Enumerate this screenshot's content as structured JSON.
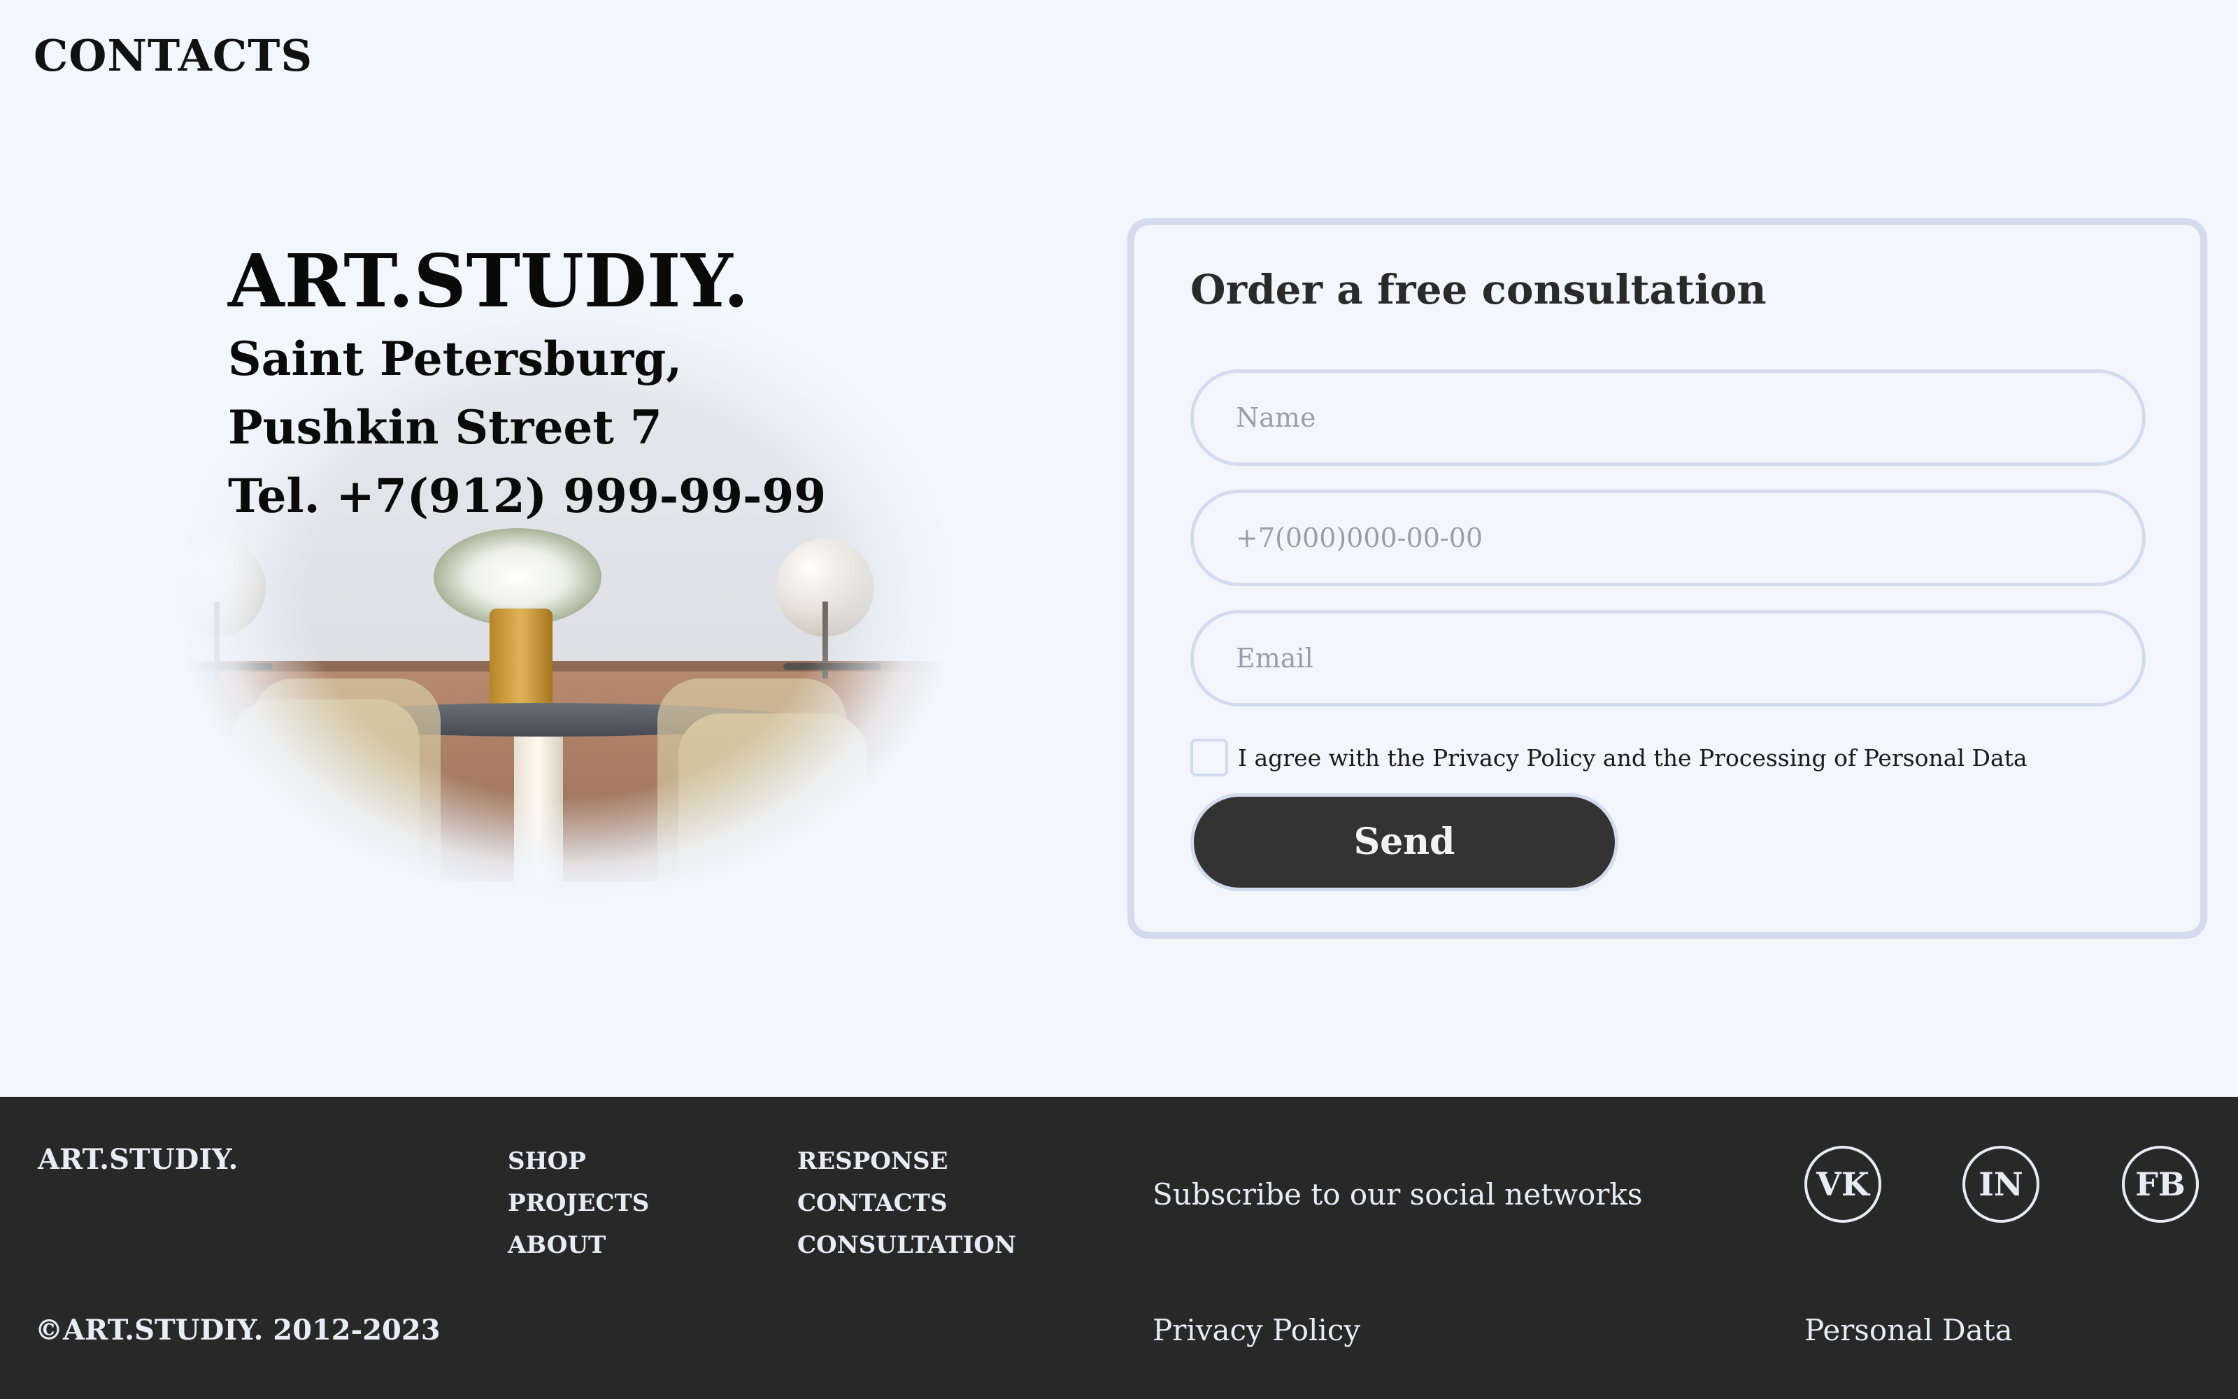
{
  "section": {
    "title": "CONTACTS"
  },
  "contact_info": {
    "brand": "ART.STUDIY.",
    "city": "Saint Petersburg,",
    "street": "Pushkin Street 7",
    "phone": "Tel. +7(912) 999-99-99"
  },
  "form": {
    "title": "Order a free consultation",
    "name_placeholder": "Name",
    "phone_placeholder": "+7(000)000-00-00",
    "email_placeholder": "Email",
    "agree_label": "I agree with the Privacy Policy and the Processing of Personal Data",
    "agree_checked": false,
    "submit_label": "Send"
  },
  "footer": {
    "brand": "ART.STUDIY.",
    "nav_col_1": [
      {
        "label": "SHOP"
      },
      {
        "label": "PROJECTS"
      },
      {
        "label": "ABOUT"
      }
    ],
    "nav_col_2": [
      {
        "label": "RESPONSE"
      },
      {
        "label": "CONTACTS"
      },
      {
        "label": "CONSULTATION"
      }
    ],
    "subscribe_text": "Subscribe to our social networks",
    "social": [
      {
        "label": "VK"
      },
      {
        "label": "IN"
      },
      {
        "label": "FB"
      }
    ],
    "copyright": "©ART.STUDIY. 2012-2023",
    "privacy_policy": "Privacy Policy",
    "personal_data": "Personal Data"
  },
  "colors": {
    "page_background": "#f2f6fd",
    "footer_background": "#292829",
    "accent_border": "#d5dbee",
    "button_background": "#333333"
  }
}
